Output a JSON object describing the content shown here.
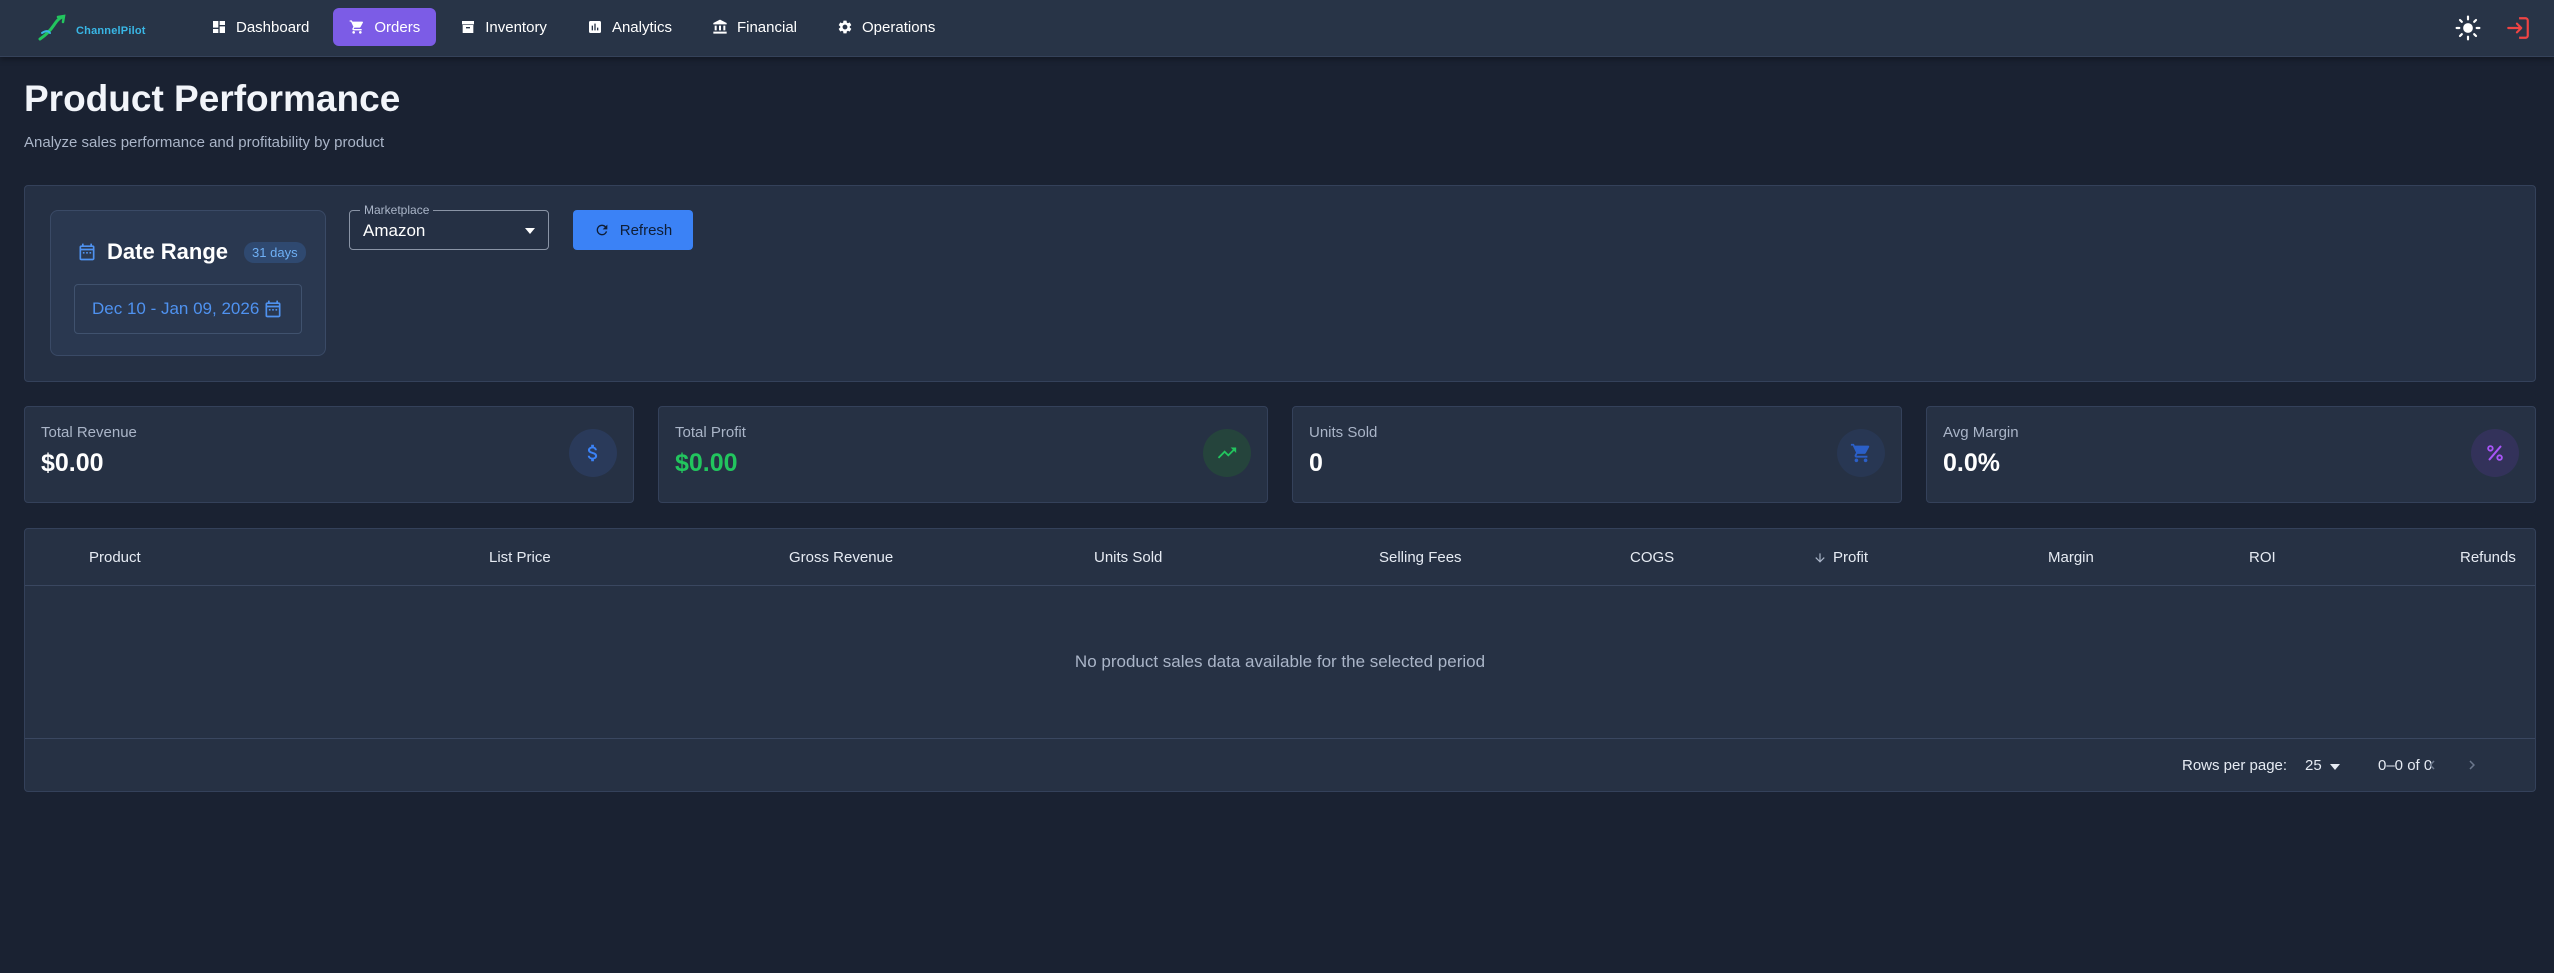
{
  "app": {
    "logo_text": "ChannelPilot"
  },
  "nav": {
    "items": [
      {
        "label": "Dashboard",
        "icon": "dashboard-icon",
        "active": false
      },
      {
        "label": "Orders",
        "icon": "cart-icon",
        "active": true
      },
      {
        "label": "Inventory",
        "icon": "archive-icon",
        "active": false
      },
      {
        "label": "Analytics",
        "icon": "analytics-icon",
        "active": false
      },
      {
        "label": "Financial",
        "icon": "bank-icon",
        "active": false
      },
      {
        "label": "Operations",
        "icon": "gear-icon",
        "active": false
      }
    ],
    "theme_icon": "sun-icon",
    "logout_icon": "logout-icon"
  },
  "header": {
    "title": "Product Performance",
    "subtitle": "Analyze sales performance and profitability by product"
  },
  "filters": {
    "date_range": {
      "title": "Date Range",
      "badge": "31 days",
      "value": "Dec 10 - Jan 09, 2026"
    },
    "marketplace": {
      "label": "Marketplace",
      "value": "Amazon"
    },
    "refresh_label": "Refresh"
  },
  "stats": [
    {
      "label": "Total Revenue",
      "value": "$0.00",
      "icon": "dollar-icon",
      "color": "#3b82f6"
    },
    {
      "label": "Total Profit",
      "value": "$0.00",
      "icon": "trending-up-icon",
      "color": "#22c55e"
    },
    {
      "label": "Units Sold",
      "value": "0",
      "icon": "cart-icon",
      "color": "#2b5fc7"
    },
    {
      "label": "Avg Margin",
      "value": "0.0%",
      "icon": "percent-icon",
      "color": "#a855f7"
    }
  ],
  "table": {
    "columns": [
      "Product",
      "List Price",
      "Gross Revenue",
      "Units Sold",
      "Selling Fees",
      "COGS",
      "Profit",
      "Margin",
      "ROI",
      "Refunds"
    ],
    "sorted_column": "Profit",
    "empty_message": "No product sales data available for the selected period",
    "footer": {
      "rows_per_page_label": "Rows per page:",
      "rows_per_page": "25",
      "range": "0–0 of 0"
    }
  },
  "colors": {
    "accent": "#7c5ce6",
    "primary": "#3b82f6",
    "success": "#22c55e",
    "background": "#1a2232"
  }
}
